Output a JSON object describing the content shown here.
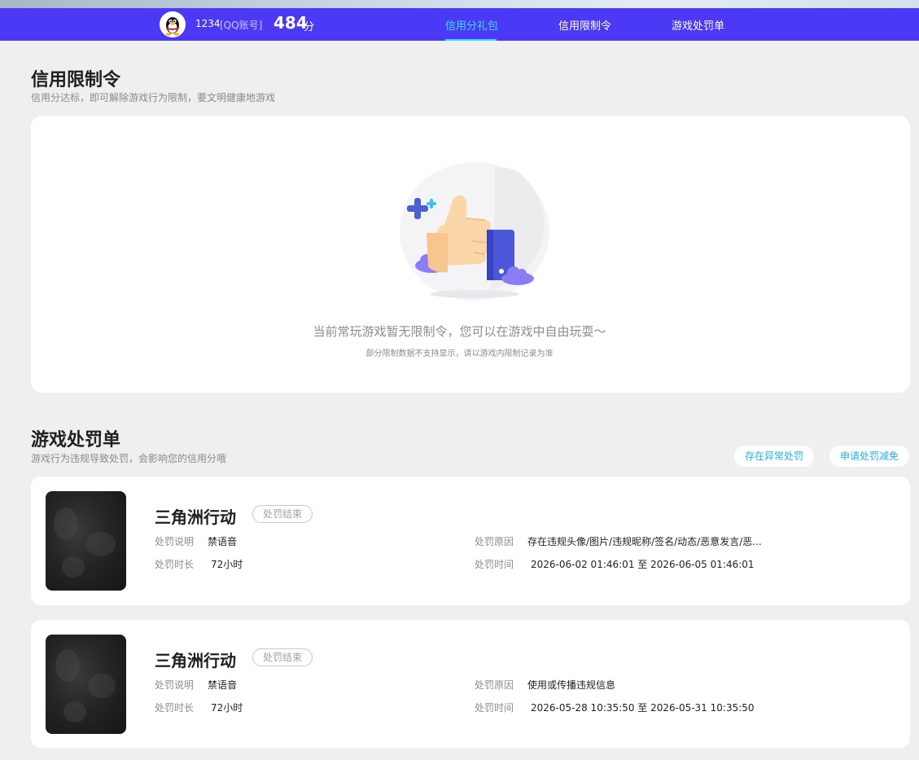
{
  "header": {
    "uid": "1234",
    "account_type": "[QQ账号]",
    "score": "484",
    "score_unit": "分",
    "nav": [
      {
        "label": "信用分礼包",
        "active": true
      },
      {
        "label": "信用限制令",
        "active": false
      },
      {
        "label": "游戏处罚单",
        "active": false
      }
    ],
    "colors": {
      "bar": "#4b39f5",
      "active": "#38e0ff"
    }
  },
  "restriction": {
    "title": "信用限制令",
    "subtitle": "信用分达标，即可解除游戏行为限制，要文明健康地游戏",
    "empty_message": "当前常玩游戏暂无限制令，您可以在游戏中自由玩耍～",
    "empty_note": "部分限制数据不支持显示，请以游戏内限制记录为准",
    "illustration_icon": "thumbs-up-icon"
  },
  "penalty": {
    "title": "游戏处罚单",
    "subtitle": "游戏行为违规导致处罚，会影响您的信用分哦",
    "actions": [
      "存在异常处罚",
      "申请处罚减免"
    ],
    "labels": {
      "desc": "处罚说明",
      "duration": "处罚时长",
      "reason": "处罚原因",
      "time": "处罚时间"
    },
    "items": [
      {
        "game": "三角洲行动",
        "status": "处罚结束",
        "desc": "禁语音",
        "duration": "72小时",
        "reason": "存在违规头像/图片/违规昵称/签名/动态/恶意发言/恶...",
        "time": "2026-06-02 01:46:01 至 2026-06-05 01:46:01"
      },
      {
        "game": "三角洲行动",
        "status": "处罚结束",
        "desc": "禁语音",
        "duration": "72小时",
        "reason": "使用或传播违规信息",
        "time": "2026-05-28 10:35:50 至 2026-05-31 10:35:50"
      }
    ]
  }
}
